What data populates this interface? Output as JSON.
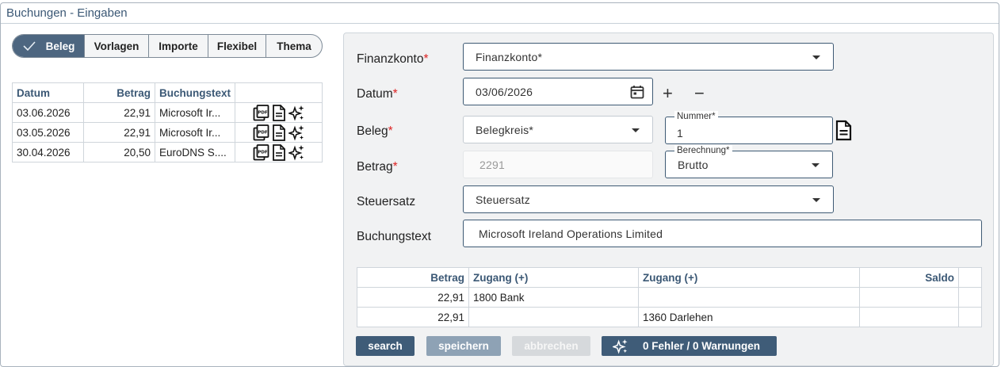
{
  "window": {
    "title": "Buchungen - Eingaben"
  },
  "tabs": [
    {
      "label": "Beleg",
      "active": true
    },
    {
      "label": "Vorlagen",
      "active": false
    },
    {
      "label": "Importe",
      "active": false
    },
    {
      "label": "Flexibel",
      "active": false
    },
    {
      "label": "Thema",
      "active": false
    }
  ],
  "bookings_table": {
    "columns": [
      "Datum",
      "Betrag",
      "Buchungstext",
      ""
    ],
    "rows": [
      {
        "datum": "03.06.2026",
        "betrag": "22,91",
        "text": "Microsoft Ir..."
      },
      {
        "datum": "03.05.2026",
        "betrag": "22,91",
        "text": "Microsoft Ir..."
      },
      {
        "datum": "30.04.2026",
        "betrag": "20,50",
        "text": "EuroDNS S...."
      }
    ],
    "row_icons": [
      "pdf-copy-icon",
      "document-icon",
      "sparkle-icon"
    ]
  },
  "form": {
    "finanzkonto": {
      "label": "Finanzkonto",
      "required": "*",
      "placeholder": "Finanzkonto*",
      "value": ""
    },
    "datum": {
      "label": "Datum",
      "required": "*",
      "value": "03/06/2026",
      "plus": "+",
      "minus": "−"
    },
    "beleg": {
      "label": "Beleg",
      "required": "*",
      "belegkreis_placeholder": "Belegkreis*",
      "nummer_label": "Nummer*",
      "nummer_value": "1"
    },
    "betrag": {
      "label": "Betrag",
      "required": "*",
      "value": "2291",
      "berechnung_label": "Berechnung*",
      "berechnung_value": "Brutto"
    },
    "steuersatz": {
      "label": "Steuersatz",
      "placeholder": "Steuersatz"
    },
    "buchungstext": {
      "label": "Buchungstext",
      "value": "Microsoft Ireland Operations Limited"
    }
  },
  "split_table": {
    "columns": [
      "Betrag",
      "Zugang (+)",
      "Zugang (+)",
      "Saldo",
      ""
    ],
    "rows": [
      {
        "betrag": "22,91",
        "zugang1": "1800 Bank",
        "zugang2": "",
        "saldo": ""
      },
      {
        "betrag": "22,91",
        "zugang1": "",
        "zugang2": "1360 Darlehen",
        "saldo": ""
      }
    ]
  },
  "buttons": {
    "search": "search",
    "save": "speichern",
    "cancel": "abbrechen",
    "status": "0 Fehler / 0 Warnungen"
  },
  "colors": {
    "accent": "#3f5c78",
    "required": "#dd2222",
    "header_text": "#3b5875"
  }
}
